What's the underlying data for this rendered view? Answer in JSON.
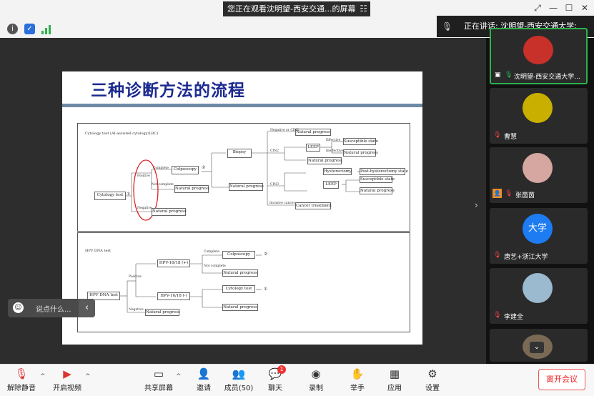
{
  "window": {
    "banner": "您正在观看沈明望-西安交通...的屏幕",
    "speaking": "正在讲话: 沈明望-西安交通大学;"
  },
  "slide": {
    "title": "三种诊断方法的流程",
    "section1": {
      "heading": "Cytology test (AI-assisted cytology/LBC)",
      "nodes": {
        "cytology": "Cytology test",
        "colposcopy": "Colposcopy",
        "biopsy": "Biopsy",
        "np1": "Natural progress",
        "np2": "Natural progress",
        "np3": "Natural progress",
        "np4": "Natural progress",
        "np5": "Natural progress",
        "np6": "Natural progress",
        "np7": "Natural progress",
        "leep1": "LEEP",
        "leep2": "LEEP",
        "hyst": "Hysterectomy",
        "post": "Post-hysterectomy state",
        "sus1": "Susceptible state",
        "sus2": "Susceptible state",
        "cancer": "Cancer treatment"
      },
      "labels": {
        "complete": "Complete",
        "positive": "Positive",
        "notcomplete": "Not complete",
        "negative": "Negative",
        "cin1": "Negative or CIN1",
        "cin2": "CIN2",
        "cin3": "CIN3",
        "invasive": "Invasive cancer",
        "effective": "Effective",
        "ineffective": "Ineffective",
        "num1": "①",
        "num2": "②"
      }
    },
    "section2": {
      "heading": "HPV DNA test",
      "nodes": {
        "hpv": "HPV DNA test",
        "hpv1618pos": "HPV-16/18 (+)",
        "hpv1618neg": "HPV-16/18 (-)",
        "colposcopy": "Colposcopy",
        "cytology": "Cytology test",
        "np1": "Natural progress",
        "np2": "Natural progress",
        "np3": "Natural progress"
      },
      "labels": {
        "positive": "Positive",
        "negative": "Negative",
        "complete": "Complete",
        "notcomplete": "Not complete",
        "num2": "②",
        "num1": "①"
      }
    }
  },
  "chat_input": {
    "placeholder": "说点什么..."
  },
  "participants": [
    {
      "name": "沈明望-西安交通大学...",
      "avatar_bg": "#c8302a"
    },
    {
      "name": "曹慧",
      "avatar_bg": "#c9b000"
    },
    {
      "name": "张茵茵",
      "avatar_bg": "#d6a6a1"
    },
    {
      "name": "唐艺+浙江大学",
      "avatar_text": "大学",
      "avatar_bg": "#1e7cf2"
    },
    {
      "name": "李建全",
      "avatar_bg": "#9bb9cf"
    }
  ],
  "toolbar": {
    "mute": "解除静音",
    "video": "开启视频",
    "share": "共享屏幕",
    "invite": "邀请",
    "members": "成员(50)",
    "chat": "聊天",
    "chat_badge": "1",
    "record": "录制",
    "raise": "举手",
    "apps": "应用",
    "settings": "设置",
    "leave": "离开会议"
  },
  "colors": {
    "accent_green": "#2bb24c",
    "leave_red": "#e22222",
    "title_blue": "#1b2a8f"
  }
}
